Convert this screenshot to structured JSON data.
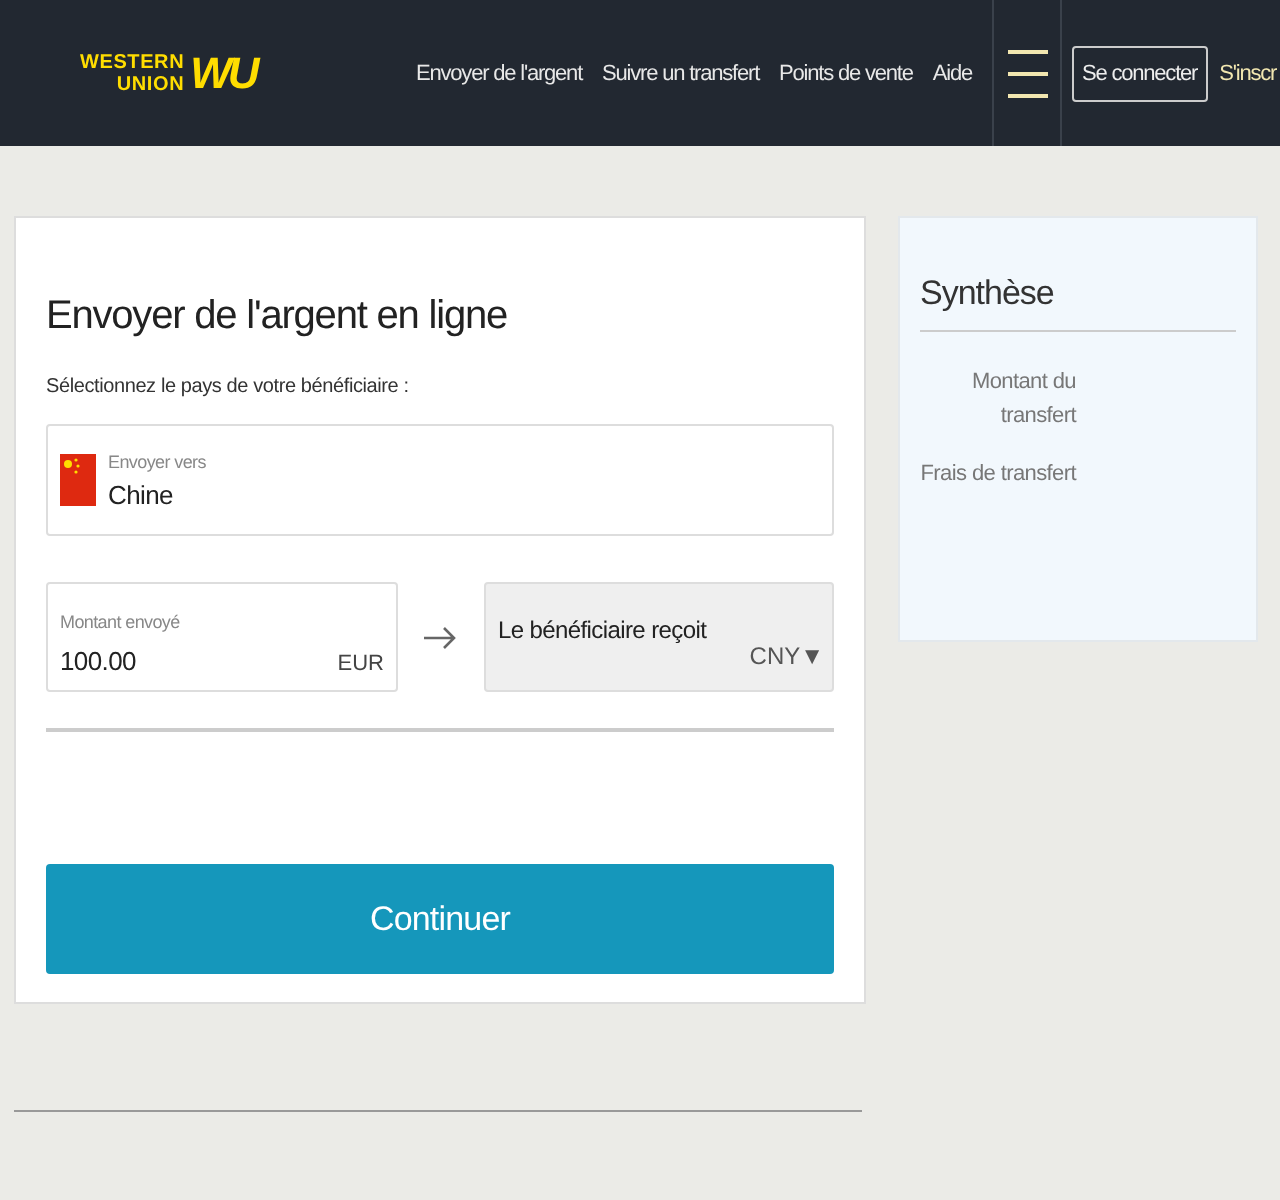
{
  "header": {
    "logo": {
      "line_1": "WESTERN",
      "line_2": "UNION",
      "mark": "WU"
    },
    "nav": [
      "Envoyer de l'argent",
      "Suivre un transfert",
      "Points de vente",
      "Aide"
    ],
    "login_button": "Se connecter",
    "signup_link": "S'inscr"
  },
  "form": {
    "title": "Envoyer de l'argent en ligne",
    "country_prompt": "Sélectionnez le pays de votre bénéficiaire :",
    "destination": {
      "label": "Envoyer vers",
      "value": "Chine"
    },
    "amount": {
      "label": "Montant envoyé",
      "value": "100.00",
      "currency": "EUR"
    },
    "receive": {
      "label": "Le bénéficiaire reçoit",
      "currency": "CNY▼"
    },
    "continue_button": "Continuer"
  },
  "summary": {
    "title": "Synthèse",
    "rows": [
      "Montant du transfert",
      "Frais de transfert"
    ]
  }
}
